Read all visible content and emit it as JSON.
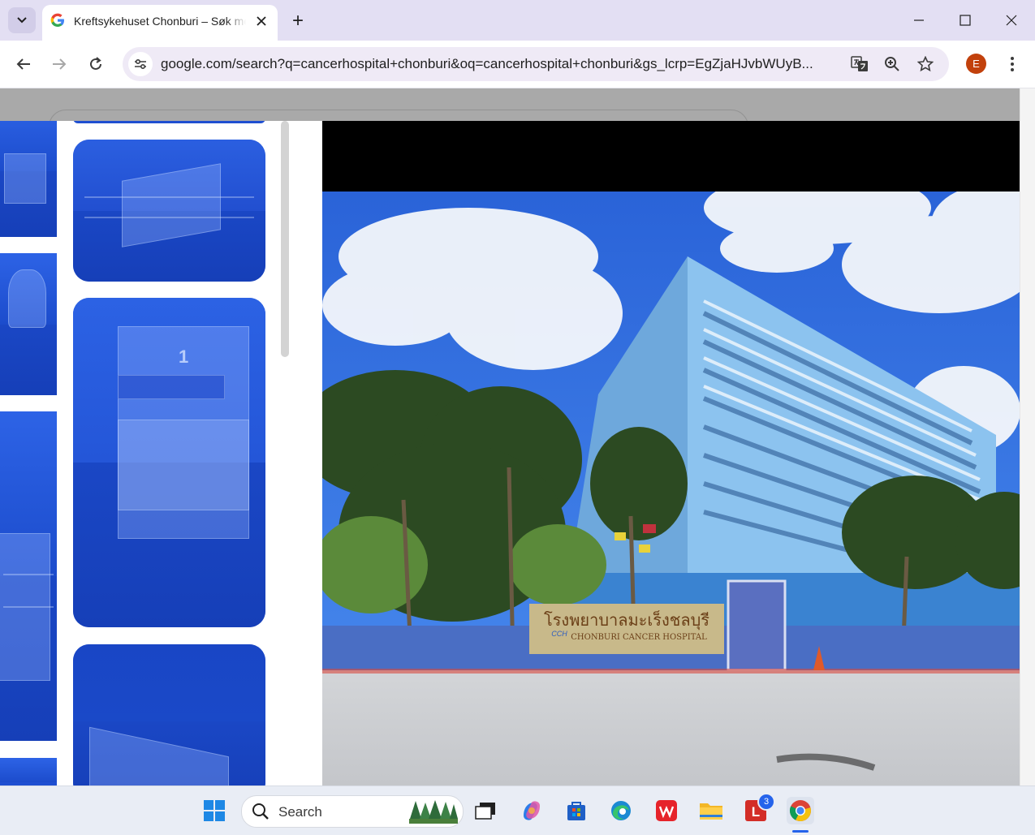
{
  "browser": {
    "tab": {
      "title": "Kreftsykehuset Chonburi – Søk med Google"
    },
    "new_tab_label": "+",
    "omnibox": {
      "url": "google.com/search?q=cancerhospital+chonburi&oq=cancerhospital+chonburi&gs_lcrp=EgZjaHJvbWUyB..."
    },
    "profile_initial": "E"
  },
  "image_panel": {
    "thumb_number": "1"
  },
  "photo": {
    "sign_thai": "โรงพยาบาลมะเร็งชลบุรี",
    "sign_english": "CHONBURI CANCER HOSPITAL",
    "sign_logo": "CCH"
  },
  "taskbar": {
    "search_placeholder": "Search",
    "notification_count": "3",
    "icons": [
      "windows-start-icon",
      "task-view-icon",
      "copilot-icon",
      "microsoft-store-icon",
      "edge-icon",
      "wps-office-icon",
      "file-explorer-icon",
      "lastpass-icon",
      "chrome-icon"
    ]
  },
  "colors": {
    "tab_strip": "#e3dff3",
    "omnibox": "#efeaf6",
    "profile": "#c2410c",
    "thumb_overlay": "#1f4fd1"
  }
}
